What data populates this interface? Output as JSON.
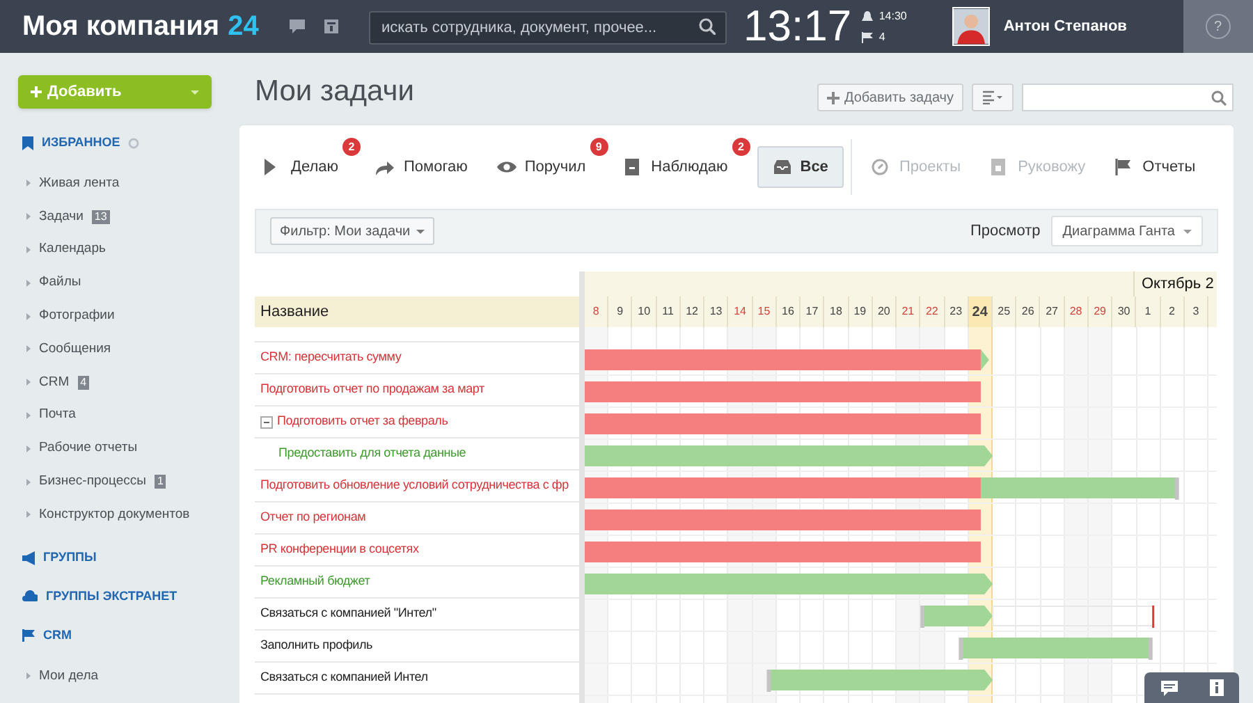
{
  "header": {
    "logo_text": "Моя компания",
    "logo_number": "24",
    "search_placeholder": "искать сотрудника, документ, прочее...",
    "clock": "13:17",
    "alarm_time": "14:30",
    "flag_count": "4",
    "user_name": "Антон Степанов",
    "help": "?"
  },
  "sidebar": {
    "add_button": "Добавить",
    "sections": [
      {
        "kind": "favorites",
        "title": "ИЗБРАННОЕ",
        "items": [
          {
            "label": "Живая лента"
          },
          {
            "label": "Задачи",
            "counter": "13"
          },
          {
            "label": "Календарь"
          },
          {
            "label": "Файлы"
          },
          {
            "label": "Фотографии"
          },
          {
            "label": "Сообщения"
          },
          {
            "label": "CRM",
            "counter": "4"
          },
          {
            "label": "Почта"
          },
          {
            "label": "Рабочие отчеты"
          },
          {
            "label": "Бизнес-процессы",
            "counter": "1"
          },
          {
            "label": "Конструктор документов"
          }
        ]
      },
      {
        "kind": "groups",
        "title": "ГРУППЫ"
      },
      {
        "kind": "extranet",
        "title": "ГРУППЫ ЭКСТРАНЕТ"
      },
      {
        "kind": "crm",
        "title": "CRM",
        "items": [
          {
            "label": "Мои дела"
          }
        ]
      }
    ]
  },
  "page_title": "Мои задачи",
  "add_task_button": "Добавить задачу",
  "tabs": [
    {
      "kind": "play",
      "label": "Делаю",
      "badge": "2",
      "selected": false,
      "disabled": false
    },
    {
      "kind": "arrow",
      "label": "Помогаю",
      "selected": false,
      "disabled": false
    },
    {
      "kind": "eye",
      "label": "Поручил",
      "badge": "9",
      "selected": false,
      "disabled": false
    },
    {
      "kind": "book",
      "label": "Наблюдаю",
      "badge": "2",
      "selected": false,
      "disabled": false
    },
    {
      "kind": "tray",
      "label": "Все",
      "selected": true,
      "disabled": false
    },
    {
      "kind": "compass",
      "label": "Проекты",
      "selected": false,
      "disabled": true
    },
    {
      "kind": "badge",
      "label": "Руковожу",
      "selected": false,
      "disabled": true
    },
    {
      "kind": "flag",
      "label": "Отчеты",
      "selected": false,
      "disabled": false
    }
  ],
  "filter": {
    "button": "Фильтр: Мои задачи",
    "view_label": "Просмотр",
    "view_value": "Диаграмма Ганта"
  },
  "gantt": {
    "month": "Октябрь 2",
    "name_header": "Название",
    "days": [
      {
        "label": "8",
        "weekend": true,
        "today": false
      },
      {
        "label": "9",
        "weekend": false,
        "today": false
      },
      {
        "label": "10",
        "weekend": false,
        "today": false
      },
      {
        "label": "11",
        "weekend": false,
        "today": false
      },
      {
        "label": "12",
        "weekend": false,
        "today": false
      },
      {
        "label": "13",
        "weekend": false,
        "today": false
      },
      {
        "label": "14",
        "weekend": true,
        "today": false
      },
      {
        "label": "15",
        "weekend": true,
        "today": false
      },
      {
        "label": "16",
        "weekend": false,
        "today": false
      },
      {
        "label": "17",
        "weekend": false,
        "today": false
      },
      {
        "label": "18",
        "weekend": false,
        "today": false
      },
      {
        "label": "19",
        "weekend": false,
        "today": false
      },
      {
        "label": "20",
        "weekend": false,
        "today": false
      },
      {
        "label": "21",
        "weekend": true,
        "today": false
      },
      {
        "label": "22",
        "weekend": true,
        "today": false
      },
      {
        "label": "23",
        "weekend": false,
        "today": false
      },
      {
        "label": "24",
        "weekend": false,
        "today": true
      },
      {
        "label": "25",
        "weekend": false,
        "today": false
      },
      {
        "label": "26",
        "weekend": false,
        "today": false
      },
      {
        "label": "27",
        "weekend": false,
        "today": false
      },
      {
        "label": "28",
        "weekend": true,
        "today": false
      },
      {
        "label": "29",
        "weekend": true,
        "today": false
      },
      {
        "label": "30",
        "weekend": false,
        "today": false
      },
      {
        "label": "1",
        "weekend": false,
        "today": false
      },
      {
        "label": "2",
        "weekend": false,
        "today": false
      },
      {
        "label": "3",
        "weekend": false,
        "today": false
      }
    ],
    "tasks": [
      {
        "name": "CRM: пересчитать сумму",
        "kind": "overdue"
      },
      {
        "name": "Подготовить отчет по продажам за март",
        "kind": "overdue"
      },
      {
        "name": "Подготовить отчет за февраль",
        "kind": "overdue",
        "expanded": true,
        "children": [
          {
            "name": "Предоставить для отчета данные",
            "kind": "active"
          }
        ]
      },
      {
        "name": "Подготовить обновление условий сотрудничества с фр",
        "kind": "overdue"
      },
      {
        "name": "Отчет по регионам",
        "kind": "overdue"
      },
      {
        "name": "PR конференции в соцсетях",
        "kind": "overdue"
      },
      {
        "name": "Рекламный бюджет",
        "kind": "active"
      },
      {
        "name": "Связаться с компанией \"Интел\"",
        "kind": "normal"
      },
      {
        "name": "Заполнить профиль",
        "kind": "normal"
      },
      {
        "name": "Связаться с компанией Интел",
        "kind": "normal"
      }
    ]
  }
}
